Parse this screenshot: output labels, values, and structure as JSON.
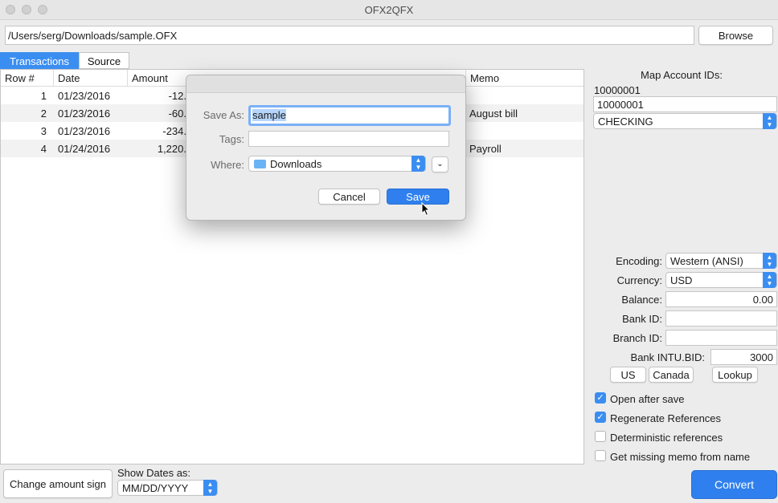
{
  "window": {
    "title": "OFX2QFX",
    "file_path": "/Users/serg/Downloads/sample.OFX",
    "browse_label": "Browse"
  },
  "tabs": [
    {
      "label": "Transactions",
      "active": true
    },
    {
      "label": "Source",
      "active": false
    }
  ],
  "table": {
    "columns": [
      "Row #",
      "Date",
      "Amount",
      "Memo"
    ],
    "rows": [
      {
        "row": "1",
        "date": "01/23/2016",
        "amount": "-12.",
        "memo": ""
      },
      {
        "row": "2",
        "date": "01/23/2016",
        "amount": "-60.",
        "memo": "August bill"
      },
      {
        "row": "3",
        "date": "01/23/2016",
        "amount": "-234.",
        "memo": ""
      },
      {
        "row": "4",
        "date": "01/24/2016",
        "amount": "1,220.",
        "memo": "Payroll"
      }
    ]
  },
  "map_accounts": {
    "title": "Map Account IDs:",
    "account_id": "10000001",
    "mapped_id": "10000001",
    "account_type": "CHECKING"
  },
  "settings": {
    "encoding_label": "Encoding:",
    "encoding_value": "Western (ANSI)",
    "currency_label": "Currency:",
    "currency_value": "USD",
    "balance_label": "Balance:",
    "balance_value": "0.00",
    "bank_id_label": "Bank ID:",
    "bank_id_value": "",
    "branch_id_label": "Branch ID:",
    "branch_id_value": "",
    "intu_bid_label": "Bank INTU.BID:",
    "intu_bid_value": "3000",
    "us_label": "US",
    "canada_label": "Canada",
    "lookup_label": "Lookup"
  },
  "options": [
    {
      "label": "Open after save",
      "checked": true
    },
    {
      "label": "Regenerate References",
      "checked": true
    },
    {
      "label": "Deterministic references",
      "checked": false
    },
    {
      "label": "Get missing memo from name",
      "checked": false
    }
  ],
  "bottom": {
    "change_sign_label": "Change amount sign",
    "show_dates_label": "Show Dates as:",
    "date_format": "MM/DD/YYYY",
    "convert_label": "Convert"
  },
  "save_dialog": {
    "save_as_label": "Save As:",
    "save_as_value": "sample",
    "tags_label": "Tags:",
    "tags_value": "",
    "where_label": "Where:",
    "where_value": "Downloads",
    "cancel_label": "Cancel",
    "save_label": "Save"
  },
  "colors": {
    "accent": "#3b8ef1",
    "primary_button": "#2f80ee",
    "selection": "#b5d5fb"
  },
  "icons": [
    "folder-icon",
    "chevron-down-icon",
    "up-down-arrows-icon",
    "checkmark-icon",
    "mouse-cursor-icon"
  ]
}
